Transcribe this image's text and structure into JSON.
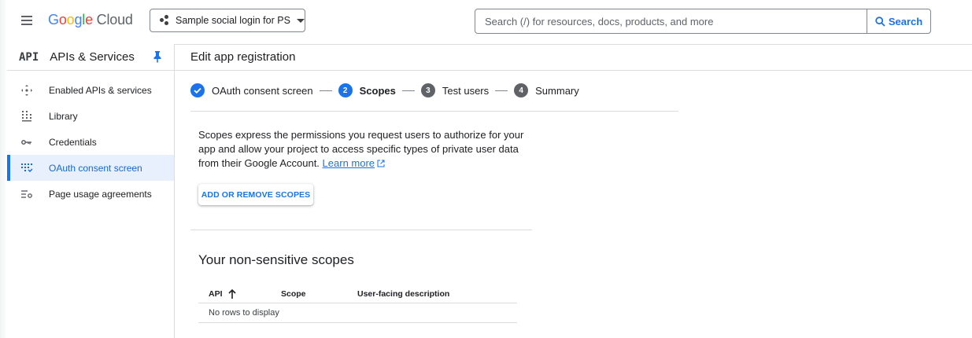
{
  "topbar": {
    "logo": {
      "g": "G",
      "o1": "o",
      "o2": "o",
      "g2": "g",
      "l": "l",
      "e": "e",
      "cloud": " Cloud"
    },
    "project": "Sample social login for PS",
    "search_placeholder": "Search (/) for resources, docs, products, and more",
    "search_button": "Search"
  },
  "sidebar": {
    "api_mark": "API",
    "title": "APIs & Services",
    "items": [
      {
        "label": "Enabled APIs & services",
        "icon": "apis-icon"
      },
      {
        "label": "Library",
        "icon": "library-icon"
      },
      {
        "label": "Credentials",
        "icon": "key-icon"
      },
      {
        "label": "OAuth consent screen",
        "icon": "consent-icon",
        "active": true
      },
      {
        "label": "Page usage agreements",
        "icon": "settings-list-icon"
      }
    ]
  },
  "main": {
    "title": "Edit app registration",
    "steps": [
      {
        "num": "",
        "label": "OAuth consent screen",
        "state": "done"
      },
      {
        "num": "2",
        "label": "Scopes",
        "state": "current"
      },
      {
        "num": "3",
        "label": "Test users",
        "state": "todo"
      },
      {
        "num": "4",
        "label": "Summary",
        "state": "todo"
      }
    ],
    "description": "Scopes express the permissions you request users to authorize for your app and allow your project to access specific types of private user data from their Google Account.",
    "learn_more": "Learn more",
    "add_scopes_button": "ADD OR REMOVE SCOPES",
    "section_title": "Your non-sensitive scopes",
    "table": {
      "columns": [
        "API",
        "Scope",
        "User-facing description"
      ],
      "empty_text": "No rows to display"
    }
  },
  "colors": {
    "accent": "#1a73e8",
    "active_bg": "#e8f0fe",
    "border": "#dadce0"
  }
}
